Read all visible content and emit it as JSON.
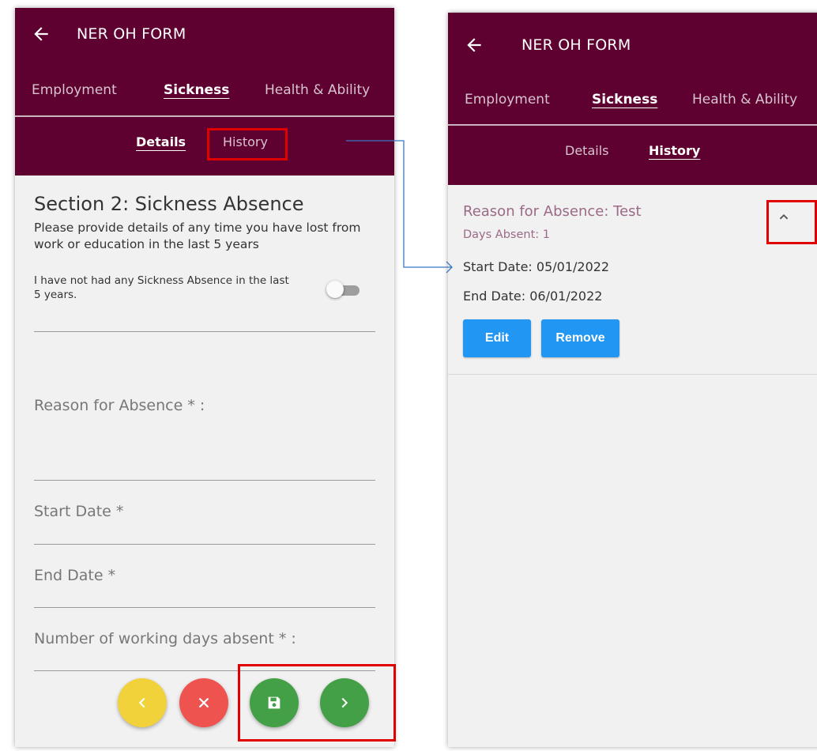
{
  "app": {
    "title": "NER OH FORM"
  },
  "tabs": [
    {
      "label": "Employment",
      "active": false
    },
    {
      "label": "Sickness",
      "active": true
    },
    {
      "label": "Health & Ability",
      "active": false
    }
  ],
  "subtabs": {
    "details": "Details",
    "history": "History"
  },
  "left_screen": {
    "active_subtab": "Details",
    "section_title": "Section 2: Sickness Absence",
    "section_description": "Please provide details of any time you have lost from work or education in the last 5 years",
    "toggle_label": "I have not had any Sickness Absence in the last 5 years.",
    "toggle_on": false,
    "fields": {
      "reason": "Reason for Absence * :",
      "start_date": "Start Date *",
      "end_date": "End Date *",
      "working_days": "Number of working days absent * :"
    },
    "fab_buttons": [
      {
        "name": "previous",
        "icon": "chevron-left-icon",
        "color": "#f2d23a"
      },
      {
        "name": "cancel",
        "icon": "close-icon",
        "color": "#ef5350"
      },
      {
        "name": "save",
        "icon": "save-icon",
        "color": "#43a047"
      },
      {
        "name": "next",
        "icon": "chevron-right-icon",
        "color": "#43a047"
      }
    ]
  },
  "right_screen": {
    "active_subtab": "History",
    "record": {
      "reason": "Reason for Absence: Test",
      "days_absent": "Days Absent: 1",
      "start_date": "Start Date: 05/01/2022",
      "end_date": "End Date: 06/01/2022",
      "expanded": true
    },
    "buttons": {
      "edit": "Edit",
      "remove": "Remove"
    }
  },
  "colors": {
    "header_bg": "#5e0030",
    "highlight": "#e00000",
    "button_blue": "#2196f3",
    "connector": "#3a78c2",
    "record_text": "#9a6a86"
  }
}
